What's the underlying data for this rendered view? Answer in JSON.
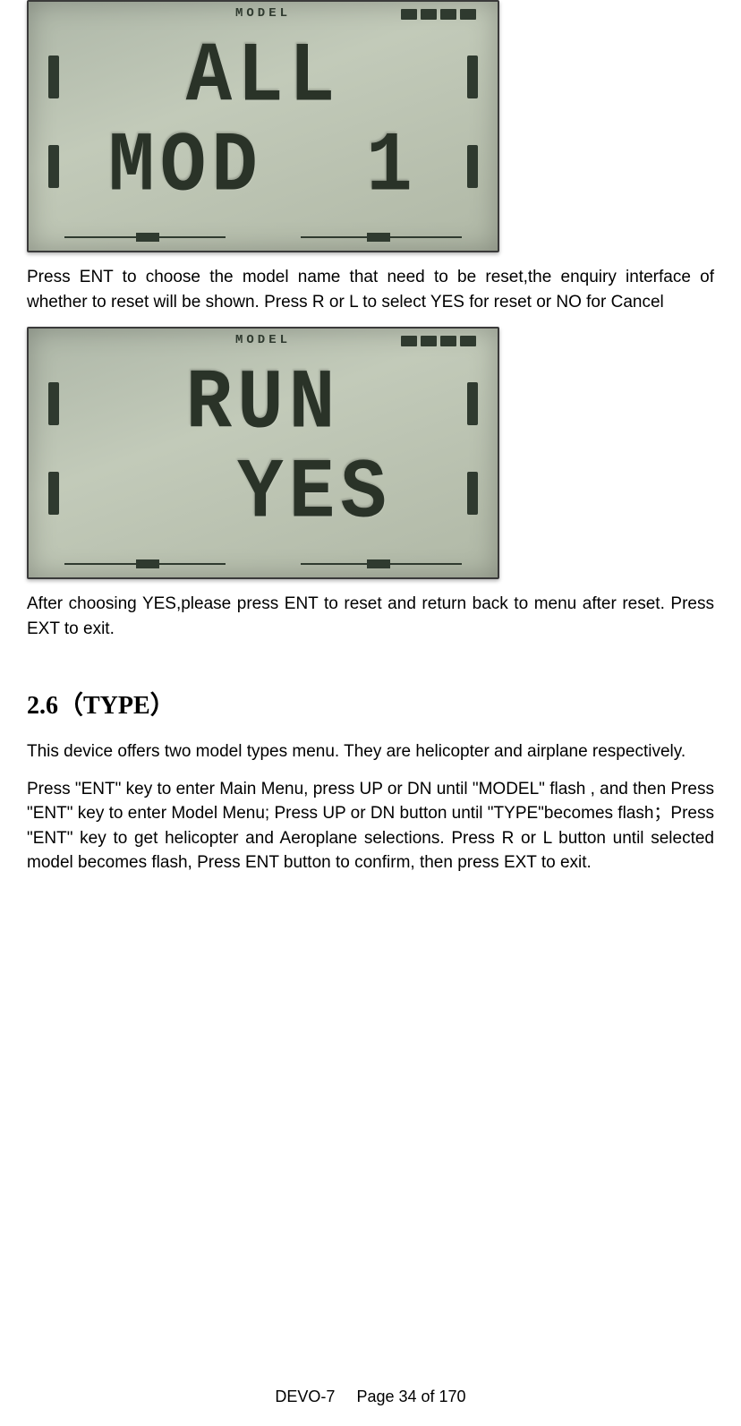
{
  "lcd1": {
    "label": "MODEL",
    "row1": "ALL",
    "row2": "MOD  1"
  },
  "paragraph1": "Press ENT to choose the model name that need to be reset,the enquiry interface of whether to reset will be shown. Press R or L to select YES for reset or NO for Cancel",
  "lcd2": {
    "label": "MODEL",
    "row1": "RUN",
    "row2": "  YES"
  },
  "paragraph2": "After choosing YES,please press ENT to reset and return back to menu after reset. Press EXT to exit.",
  "section_heading": "2.6（TYPE）",
  "paragraph3": "This device offers two model types menu. They are helicopter and airplane respectively.",
  "paragraph4": "Press \"ENT\" key to enter Main Menu, press UP or DN until \"MODEL\" flash , and then Press \"ENT\" key to enter Model Menu; Press UP or DN button until \"TYPE\"becomes flash；Press \"ENT\" key to get helicopter and Aeroplane selections. Press R or L button until selected model becomes flash, Press ENT button to confirm, then press EXT to exit.",
  "footer": {
    "device": "DEVO-7",
    "page_label": "Page 34 of 170"
  }
}
